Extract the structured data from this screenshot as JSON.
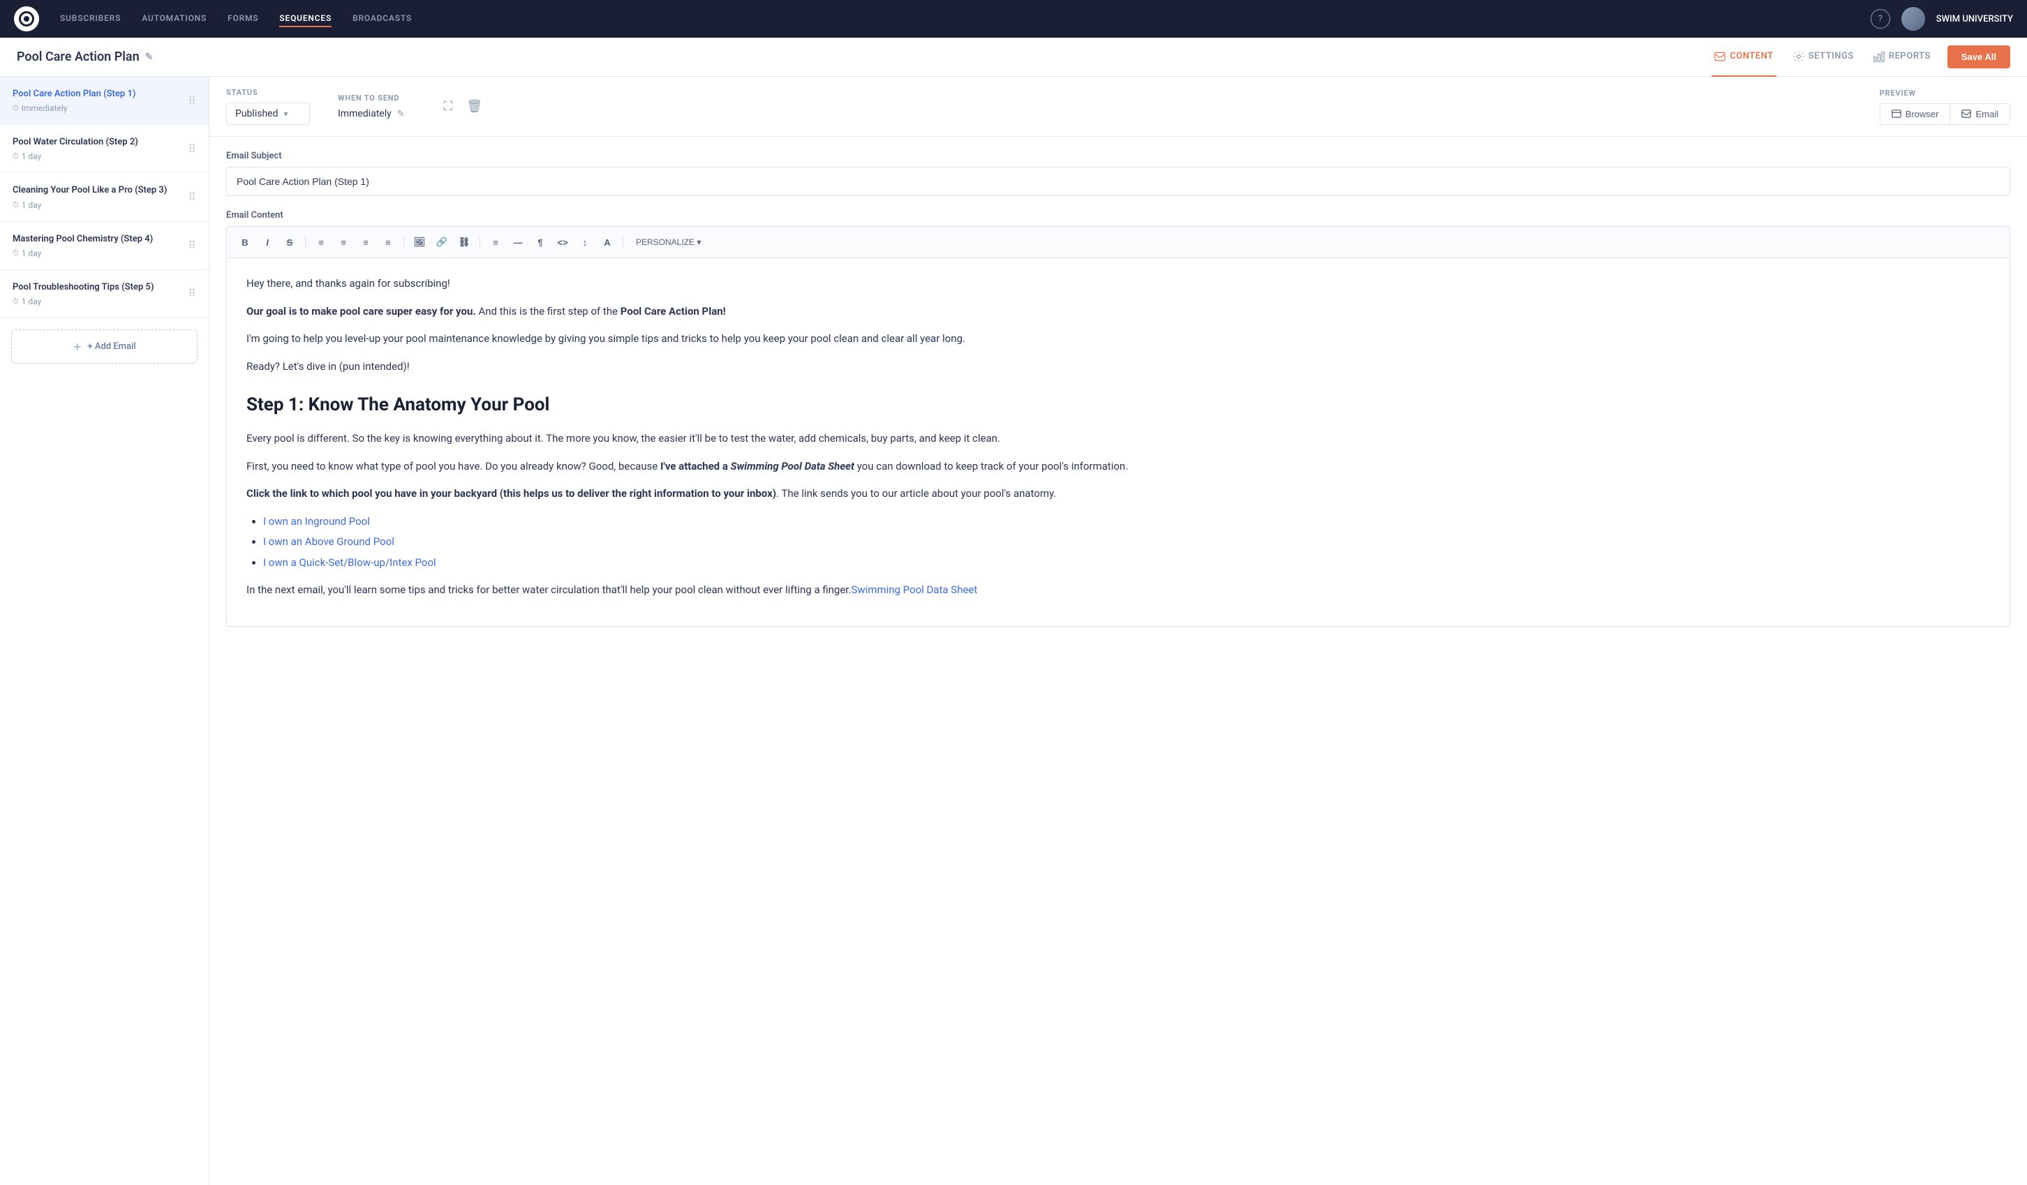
{
  "app": {
    "logo_alt": "Drip logo"
  },
  "topnav": {
    "items": [
      {
        "label": "SUBSCRIBERS",
        "active": false
      },
      {
        "label": "AUTOMATIONS",
        "active": false
      },
      {
        "label": "FORMS",
        "active": false
      },
      {
        "label": "SEQUENCES",
        "active": true
      },
      {
        "label": "BROADCASTS",
        "active": false
      }
    ],
    "help_label": "?",
    "brand_name": "SWIM UNIVERSITY"
  },
  "header": {
    "title": "Pool Care Action Plan",
    "edit_icon": "✎",
    "tabs": [
      {
        "label": "CONTENT",
        "icon": "envelope",
        "active": true
      },
      {
        "label": "SETTINGS",
        "icon": "gear",
        "active": false
      },
      {
        "label": "REPORTS",
        "icon": "bar-chart",
        "active": false
      }
    ],
    "save_btn": "Save All"
  },
  "status_bar": {
    "status_label": "STATUS",
    "status_value": "Published",
    "when_label": "WHEN TO SEND",
    "when_value": "Immediately",
    "preview_label": "PREVIEW",
    "browser_btn": "Browser",
    "email_btn": "Email"
  },
  "email": {
    "subject_label": "Email Subject",
    "subject_value": "Pool Care Action Plan (Step 1)",
    "content_label": "Email Content"
  },
  "toolbar": {
    "buttons": [
      "B",
      "I",
      "S",
      "≡",
      "≡",
      "≡",
      "≡",
      "🖼",
      "🔗",
      "🔗",
      "≡",
      "—",
      "¶",
      "<>",
      "↕",
      "A"
    ],
    "personalize": "PERSONALIZE ▾"
  },
  "sidebar": {
    "items": [
      {
        "title": "Pool Care Action Plan (Step 1)",
        "meta": "Immediately",
        "active": true
      },
      {
        "title": "Pool Water Circulation (Step 2)",
        "meta": "1 day",
        "active": false
      },
      {
        "title": "Cleaning Your Pool Like a Pro (Step 3)",
        "meta": "1 day",
        "active": false
      },
      {
        "title": "Mastering Pool Chemistry (Step 4)",
        "meta": "1 day",
        "active": false
      },
      {
        "title": "Pool Troubleshooting Tips (Step 5)",
        "meta": "1 day",
        "active": false
      }
    ],
    "add_email": "+ Add Email"
  },
  "content": {
    "greeting": "Hey there, and thanks again for subscribing!",
    "goal_bold": "Our goal is to make pool care super easy for you.",
    "goal_rest": " And this is the first step of the ",
    "plan_bold": "Pool Care Action Plan!",
    "intro": "I'm going to help you level-up your pool maintenance knowledge by giving you simple tips and tricks to help you keep your pool clean and clear all year long.",
    "ready": "Ready? Let's dive in (pun intended)!",
    "step_heading": "Step 1: Know The Anatomy Your Pool",
    "step_desc": "Every pool is different. So the key is knowing everything about it. The more you know, the easier it'll be to test the water, add chemicals, buy parts, and keep it clean.",
    "data_sheet_before": "First, you need to know what type of pool you have. Do you already know? Good, because ",
    "data_sheet_bold_ive": "I've attached a ",
    "data_sheet_italic": "Swimming Pool Data Sheet",
    "data_sheet_after": " you can download to keep track of your pool's information.",
    "click_link_bold": "Click the link to which pool you have in your backyard (this helps us to deliver the right information to your inbox)",
    "click_link_rest": ". The link sends you to our article about your pool's anatomy.",
    "pool_links": [
      {
        "label": "I own an Inground Pool"
      },
      {
        "label": "I own an Above Ground Pool"
      },
      {
        "label": "I own a Quick-Set/Blow-up/Intex Pool"
      }
    ],
    "closing": "In the next email, you'll learn some tips and tricks for better water circulation that'll help your pool clean without ever lifting a finger.",
    "closing_link": "Swimming Pool Data Sheet"
  }
}
